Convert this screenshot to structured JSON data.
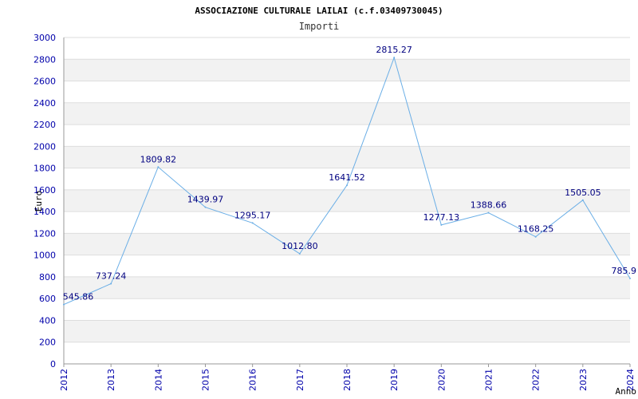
{
  "chart_data": {
    "type": "line",
    "title": "ASSOCIAZIONE CULTURALE LAILAI (c.f.03409730045)",
    "subtitle": "Importi",
    "xlabel": "Anno",
    "ylabel": "Euro",
    "categories": [
      "2012",
      "2013",
      "2014",
      "2015",
      "2016",
      "2017",
      "2018",
      "2019",
      "2020",
      "2021",
      "2022",
      "2023",
      "2024"
    ],
    "series": [
      {
        "values": [
          545.86,
          737.24,
          1809.82,
          1439.97,
          1295.17,
          1012.8,
          1641.52,
          2815.27,
          1277.13,
          1388.66,
          1168.25,
          1505.05,
          785.9
        ]
      }
    ],
    "data_labels": [
      "545.86",
      "737.24",
      "1809.82",
      "1439.97",
      "1295.17",
      "1012.80",
      "1641.52",
      "2815.27",
      "1277.13",
      "1388.66",
      "1168.25",
      "1505.05",
      "785.9"
    ],
    "y_ticks": [
      0,
      200,
      400,
      600,
      800,
      1000,
      1200,
      1400,
      1600,
      1800,
      2000,
      2200,
      2400,
      2600,
      2800,
      3000
    ],
    "ylim": [
      0,
      3000
    ],
    "grid": true,
    "legend": "none",
    "colors": {
      "line": "#6aaee6",
      "tick_text": "#0000aa",
      "data_label": "#000080",
      "band": "#f2f2f2",
      "grid": "#dddddd",
      "axis": "#999999"
    }
  }
}
